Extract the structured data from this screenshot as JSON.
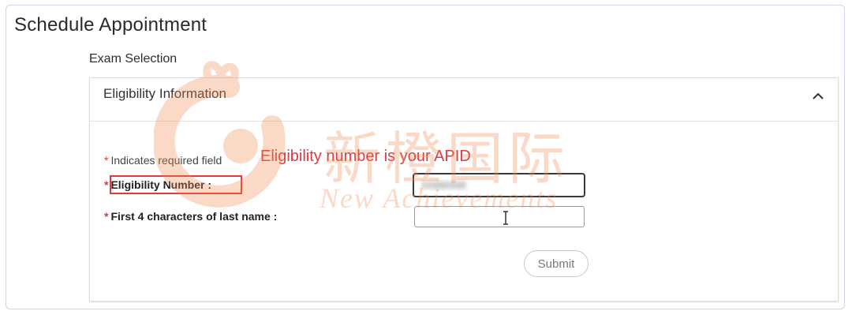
{
  "header": {
    "title": "Schedule Appointment"
  },
  "section": {
    "label": "Exam Selection"
  },
  "panel": {
    "title": "Eligibility Information",
    "required_note": "Indicates required field",
    "annotation": "Eligibility number is your APID",
    "fields": [
      {
        "label": "Eligibility Number :",
        "value": "34986998",
        "required": true
      },
      {
        "label": "First 4 characters of last name :",
        "value": "",
        "required": true
      }
    ],
    "submit_label": "Submit"
  },
  "watermark": {
    "cn": "新橙国际",
    "en": "New Achievements"
  },
  "colors": {
    "annotation": "#e0393e",
    "required_star": "#d63a2f",
    "watermark": "#f08a55"
  }
}
